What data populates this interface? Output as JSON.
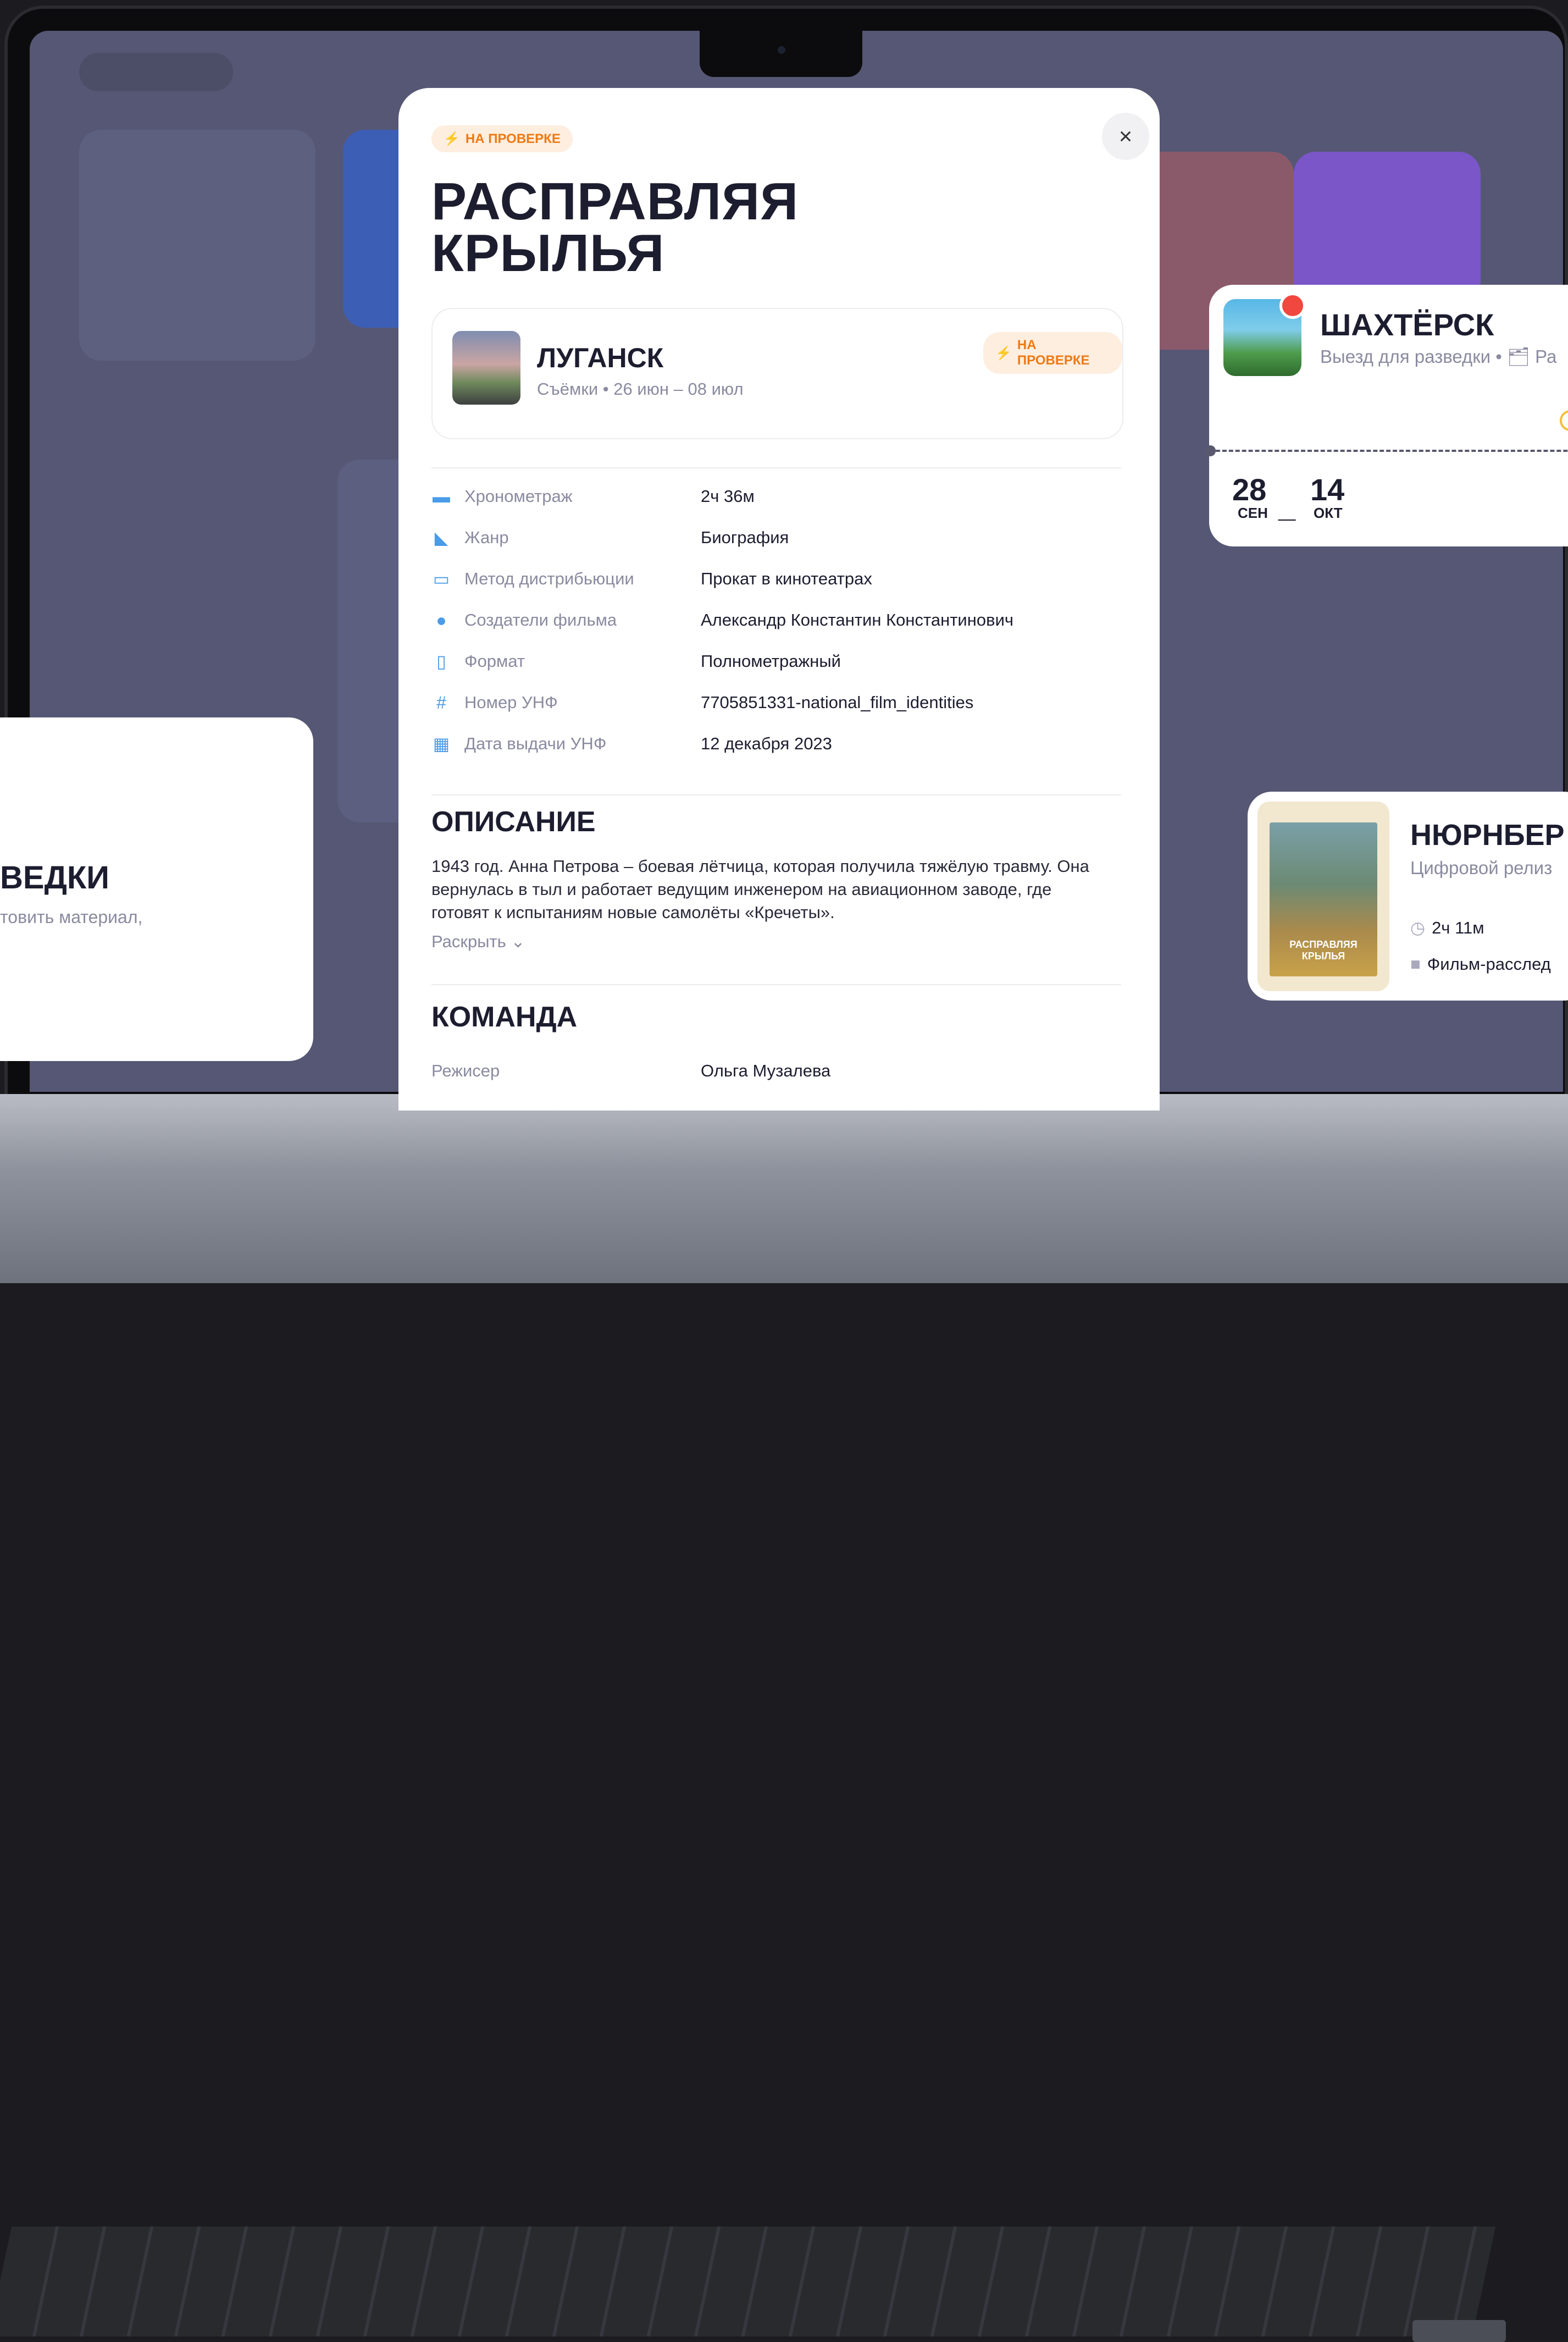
{
  "modal": {
    "status_badge": "НА ПРОВЕРКЕ",
    "title_line1": "РАСПРАВЛЯЯ",
    "title_line2": "КРЫЛЬЯ",
    "close_icon": "×",
    "location": {
      "title": "ЛУГАНСК",
      "subtitle": "Съёмки • 26 июн – 08 июл",
      "badge": "НА ПРОВЕРКЕ"
    },
    "properties": [
      {
        "icon": "film-icon",
        "label": "Хронометраж",
        "value": "2ч 36м"
      },
      {
        "icon": "clapper-icon",
        "label": "Жанр",
        "value": "Биография"
      },
      {
        "icon": "display-icon",
        "label": "Метод дистрибьюции",
        "value": "Прокат в кинотеатрах"
      },
      {
        "icon": "lightbulb-icon",
        "label": "Создатели фильма",
        "value": "Александр Константин Константинович"
      },
      {
        "icon": "document-icon",
        "label": "Формат",
        "value": "Полнометражный"
      },
      {
        "icon": "hash-icon",
        "label": "Номер УНФ",
        "value": "7705851331-national_film_identities"
      },
      {
        "icon": "calendar-icon",
        "label": "Дата выдачи УНФ",
        "value": "12 декабря 2023"
      }
    ],
    "description_heading": "ОПИСАНИЕ",
    "description_text": "1943 год. Анна Петрова – боевая лётчица, которая получила тяжёлую травму. Она вернулась в тыл и работает ведущим инженером на авиационном заводе, где готовят к испытаниям новые самолёты «Кречеты».",
    "expand_label": "Раскрыть",
    "team_heading": "КОМАНДА",
    "team": [
      {
        "role": "Режисер",
        "name": "Ольга Музалева"
      }
    ]
  },
  "card_shakhtersk": {
    "title": "ШАХТЁРСК",
    "subtitle": "Выезд для разведки • 🗂 Ра",
    "start_day": "28",
    "start_month": "СЕН",
    "end_day": "14",
    "end_month": "ОКТ",
    "dash": "_"
  },
  "card_left": {
    "title": "ВЕДКИ",
    "subtitle": "товить материал,"
  },
  "card_nuremberg": {
    "title": "НЮРНБЕР",
    "subtitle": "Цифровой релиз",
    "duration": "2ч 11м",
    "type": "Фильм-расслед",
    "poster_text": "РАСПРАВЛЯЯ КРЫЛЬЯ"
  },
  "colors": {
    "accent_orange": "#ee7a14",
    "badge_bg": "#fdeee0",
    "title_navy": "#1d1d30",
    "muted_gray": "#8a8aa0",
    "icon_blue": "#4a9be8",
    "backdrop": "#565774"
  }
}
